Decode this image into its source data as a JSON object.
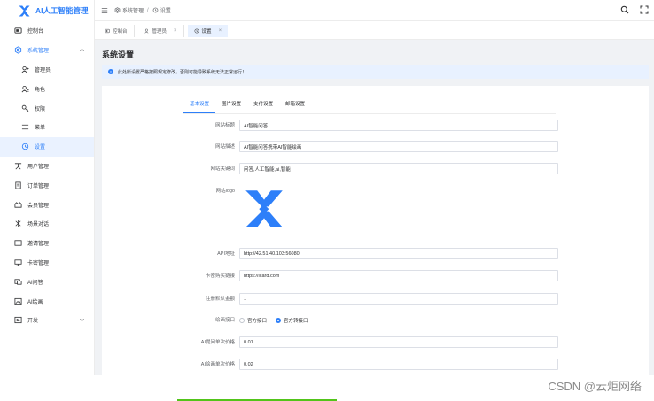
{
  "brand": {
    "title": "AI人工智能管理",
    "accent": "#2d7ff9"
  },
  "sidebar": {
    "items": [
      {
        "label": "控制台",
        "icon": "dashboard-icon"
      },
      {
        "label": "系统管理",
        "icon": "settings-icon",
        "expanded": true
      },
      {
        "label": "管理员",
        "icon": "admin-user-icon",
        "sub": true
      },
      {
        "label": "角色",
        "icon": "role-icon",
        "sub": true
      },
      {
        "label": "权限",
        "icon": "key-icon",
        "sub": true
      },
      {
        "label": "菜单",
        "icon": "menu-list-icon",
        "sub": true
      },
      {
        "label": "设置",
        "icon": "gear-icon",
        "sub": true,
        "active": true
      },
      {
        "label": "用户管理",
        "icon": "users-icon"
      },
      {
        "label": "订单管理",
        "icon": "order-icon"
      },
      {
        "label": "会员管理",
        "icon": "member-icon"
      },
      {
        "label": "场景对话",
        "icon": "chat-scene-icon"
      },
      {
        "label": "邀请管理",
        "icon": "invite-icon"
      },
      {
        "label": "卡密管理",
        "icon": "card-icon"
      },
      {
        "label": "AI问答",
        "icon": "qa-icon"
      },
      {
        "label": "AI绘画",
        "icon": "image-icon"
      },
      {
        "label": "开发",
        "icon": "dev-icon",
        "collapsed": true
      }
    ]
  },
  "header": {
    "breadcrumb": [
      "系统管理",
      "设置"
    ]
  },
  "tabs": [
    {
      "label": "控制台",
      "closable": false
    },
    {
      "label": "管理员",
      "closable": true
    },
    {
      "label": "设置",
      "closable": true,
      "active": true
    }
  ],
  "page": {
    "title": "系统设置",
    "alert": "此处所设置严格按照规定修改，否则可能导致系统无法正常运行！"
  },
  "form_tabs": [
    "基本设置",
    "图片设置",
    "支付设置",
    "邮箱设置"
  ],
  "form": {
    "site_title_label": "网站标题",
    "site_title_value": "AI智能问答",
    "site_desc_label": "网站描述",
    "site_desc_value": "AI智能问答携带AI智能绘画",
    "site_keywords_label": "网站关键词",
    "site_keywords_value": "问答,人工智能,ai,智能",
    "site_logo_label": "网站logo",
    "api_label": "API地址",
    "api_value": "http://42.51.40.103:56080",
    "card_url_label": "卡密购买链接",
    "card_url_value": "https://icard.com",
    "register_label": "注册默认金额",
    "register_value": "1",
    "draw_api_label": "绘画接口",
    "draw_api_options": [
      "官方接口",
      "官方转接口"
    ],
    "draw_api_selected": "官方转接口",
    "qa_price_label": "AI提问单次价格",
    "qa_price_value": "0.01",
    "draw_price_label": "AI绘画单次价格",
    "draw_price_value": "0.02"
  },
  "watermark": "CSDN @云炬网络"
}
